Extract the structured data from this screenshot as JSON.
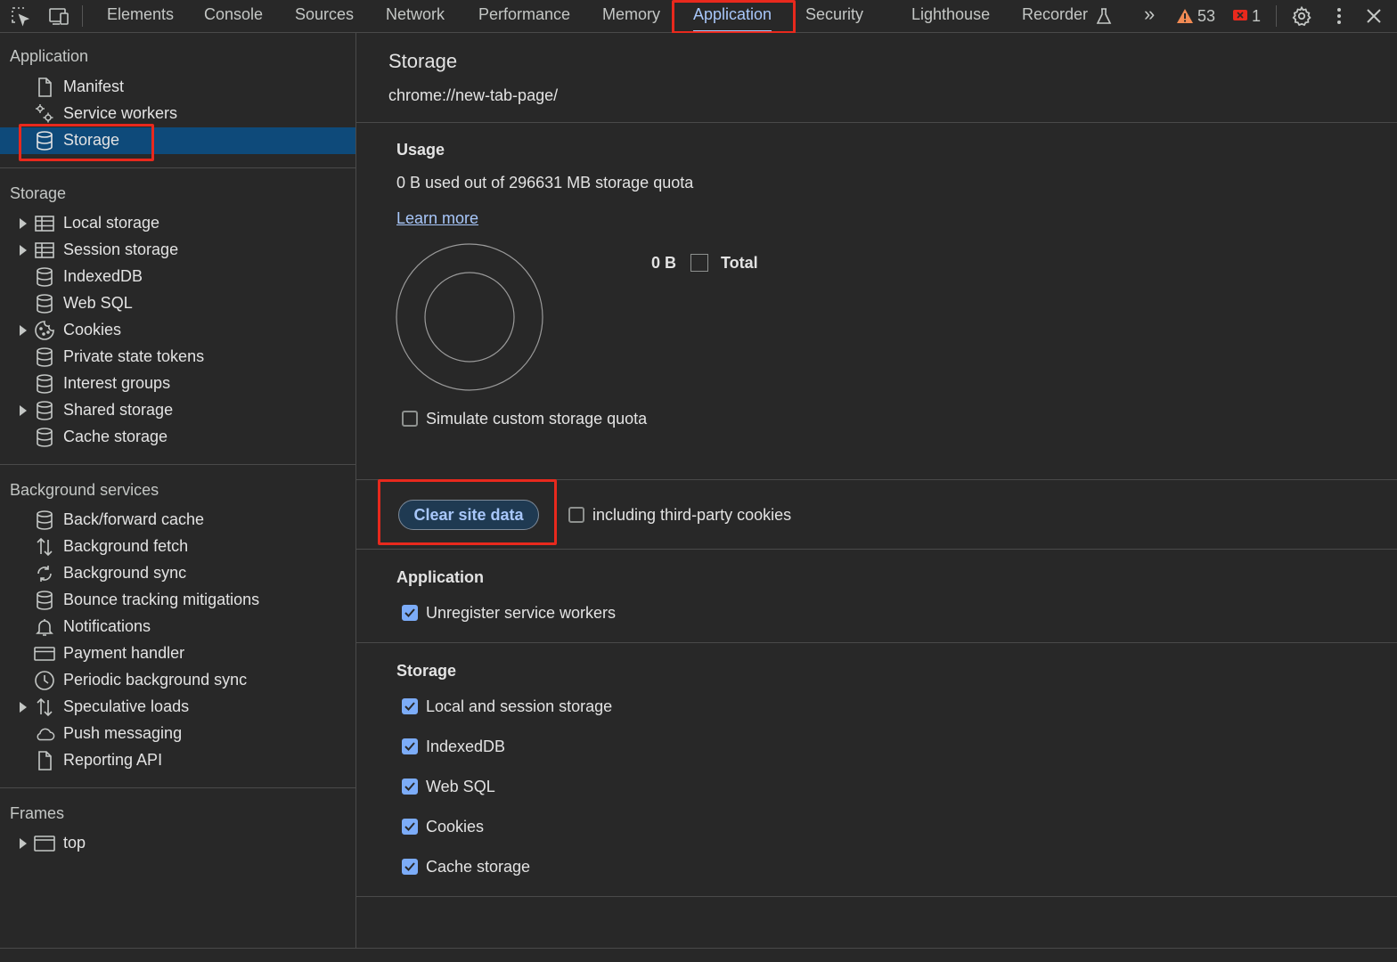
{
  "toolbar": {
    "tabs": [
      "Elements",
      "Console",
      "Sources",
      "Network",
      "Performance",
      "Memory",
      "Application",
      "Security",
      "Lighthouse",
      "Recorder"
    ],
    "active_tab": "Application",
    "more_tabs": "»",
    "warnings_count": "53",
    "errors_count": "1"
  },
  "sidebar": {
    "application": {
      "title": "Application",
      "items": [
        "Manifest",
        "Service workers",
        "Storage"
      ]
    },
    "storage": {
      "title": "Storage",
      "items": [
        "Local storage",
        "Session storage",
        "IndexedDB",
        "Web SQL",
        "Cookies",
        "Private state tokens",
        "Interest groups",
        "Shared storage",
        "Cache storage"
      ]
    },
    "background": {
      "title": "Background services",
      "items": [
        "Back/forward cache",
        "Background fetch",
        "Background sync",
        "Bounce tracking mitigations",
        "Notifications",
        "Payment handler",
        "Periodic background sync",
        "Speculative loads",
        "Push messaging",
        "Reporting API"
      ]
    },
    "frames": {
      "title": "Frames",
      "items": [
        "top"
      ]
    }
  },
  "main": {
    "title": "Storage",
    "origin": "chrome://new-tab-page/",
    "usage": {
      "heading": "Usage",
      "text": "0 B used out of 296631 MB storage quota",
      "learn_more": "Learn more",
      "legend_value": "0 B",
      "legend_label": "Total",
      "simulate_label": "Simulate custom storage quota"
    },
    "clear": {
      "button": "Clear site data",
      "third_party_label": "including third-party cookies"
    },
    "application_section": {
      "heading": "Application",
      "options": [
        "Unregister service workers"
      ]
    },
    "storage_section": {
      "heading": "Storage",
      "options": [
        "Local and session storage",
        "IndexedDB",
        "Web SQL",
        "Cookies",
        "Cache storage"
      ]
    }
  },
  "colors": {
    "accent": "#a8c7fa",
    "highlight_box": "#e8291d",
    "selected_row": "#0e4a7a",
    "warning": "#f28b54",
    "error": "#e8291d"
  }
}
